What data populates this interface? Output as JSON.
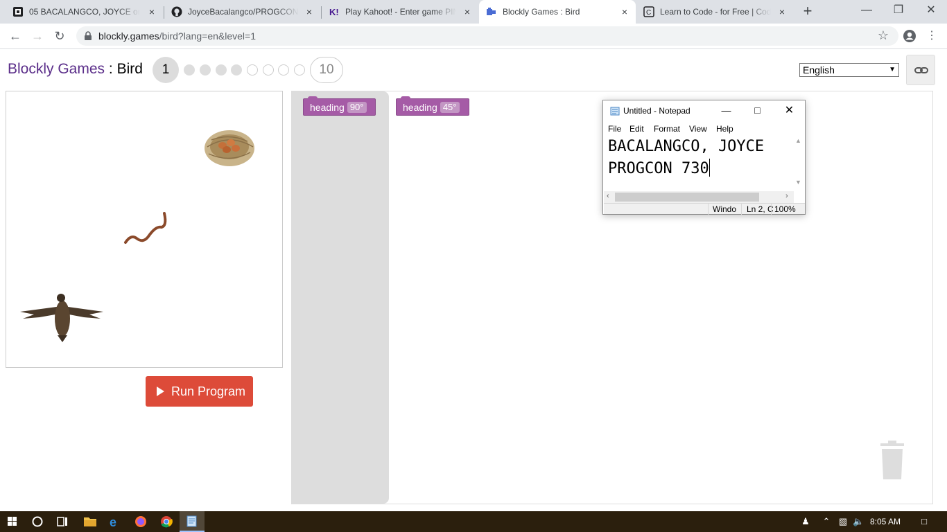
{
  "browser": {
    "tabs": [
      {
        "title": "05 BACALANGCO, JOYCE on 20",
        "close": "×"
      },
      {
        "title": "JoyceBacalangco/PROGCON: M",
        "close": "×"
      },
      {
        "title": "Play Kahoot! - Enter game PIN",
        "close": "×"
      },
      {
        "title": "Blockly Games : Bird",
        "close": "×"
      },
      {
        "title": "Learn to Code - for Free | Code",
        "close": "×"
      }
    ],
    "url_host": "blockly.games",
    "url_path": "/bird?lang=en&level=1"
  },
  "page": {
    "brand": "Blockly Games",
    "separator": " : ",
    "game": "Bird",
    "current_level": "1",
    "last_level": "10",
    "language": "English",
    "run_label": "Run Program"
  },
  "blocks": [
    {
      "label": "heading",
      "angle": "90°"
    },
    {
      "label": "heading",
      "angle": "45°"
    }
  ],
  "notepad": {
    "title": "Untitled - Notepad",
    "menu": [
      "File",
      "Edit",
      "Format",
      "View",
      "Help"
    ],
    "line1": "BACALANGCO, JOYCE",
    "line2": "PROGCON 730",
    "status_encoding": "Windo",
    "status_position": "Ln 2, C",
    "status_zoom": "100%"
  },
  "taskbar": {
    "clock": "8:05 AM"
  },
  "colors": {
    "brand_purple": "#5a2d89",
    "block_purple": "#a55ba6",
    "run_red": "#dd4b39",
    "taskbar": "#2b1f0d"
  }
}
